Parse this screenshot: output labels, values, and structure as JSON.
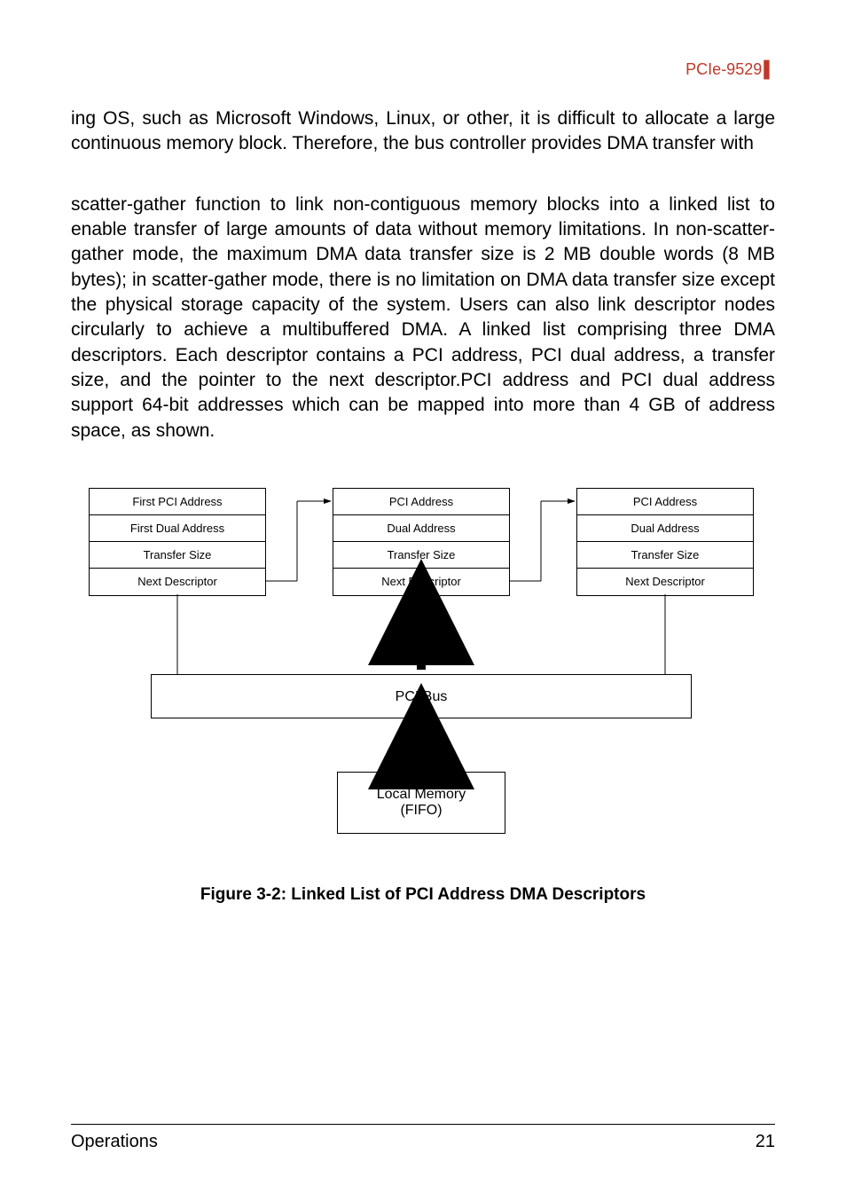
{
  "header": {
    "product": "PCIe-9529"
  },
  "para1": "ing OS, such as Microsoft Windows, Linux, or other, it is difficult to allocate a large continuous memory block. Therefore, the bus controller provides DMA transfer with",
  "para2": "scatter-gather function to link non-contiguous memory blocks into a linked list to enable transfer of large amounts of data without memory limitations. In non-scatter-gather mode, the maximum DMA data transfer size is 2 MB double words (8 MB bytes); in scatter-gather mode, there is no limitation on DMA data transfer size except the physical storage capacity of the system. Users can also link descriptor nodes circularly to achieve a multibuffered DMA. A linked list comprising three DMA descriptors. Each descriptor contains a PCI address, PCI dual address, a transfer size, and the pointer to the next descriptor.PCI address and PCI dual address support 64-bit addresses which can be mapped into more than 4 GB of address space, as shown.",
  "diagram": {
    "block1": {
      "r1": "First PCI Address",
      "r2": "First Dual Address",
      "r3": "Transfer Size",
      "r4": "Next Descriptor"
    },
    "block2": {
      "r1": "PCI Address",
      "r2": "Dual Address",
      "r3": "Transfer Size",
      "r4": "Next Descriptor"
    },
    "block3": {
      "r1": "PCI Address",
      "r2": "Dual Address",
      "r3": "Transfer Size",
      "r4": "Next Descriptor"
    },
    "pci_bus": "PCI Bus",
    "local_mem_l1": "Local Memory",
    "local_mem_l2": "(FIFO)"
  },
  "figure_caption": "Figure 3-2: Linked List of PCI Address DMA Descriptors",
  "footer": {
    "section": "Operations",
    "page": "21"
  }
}
